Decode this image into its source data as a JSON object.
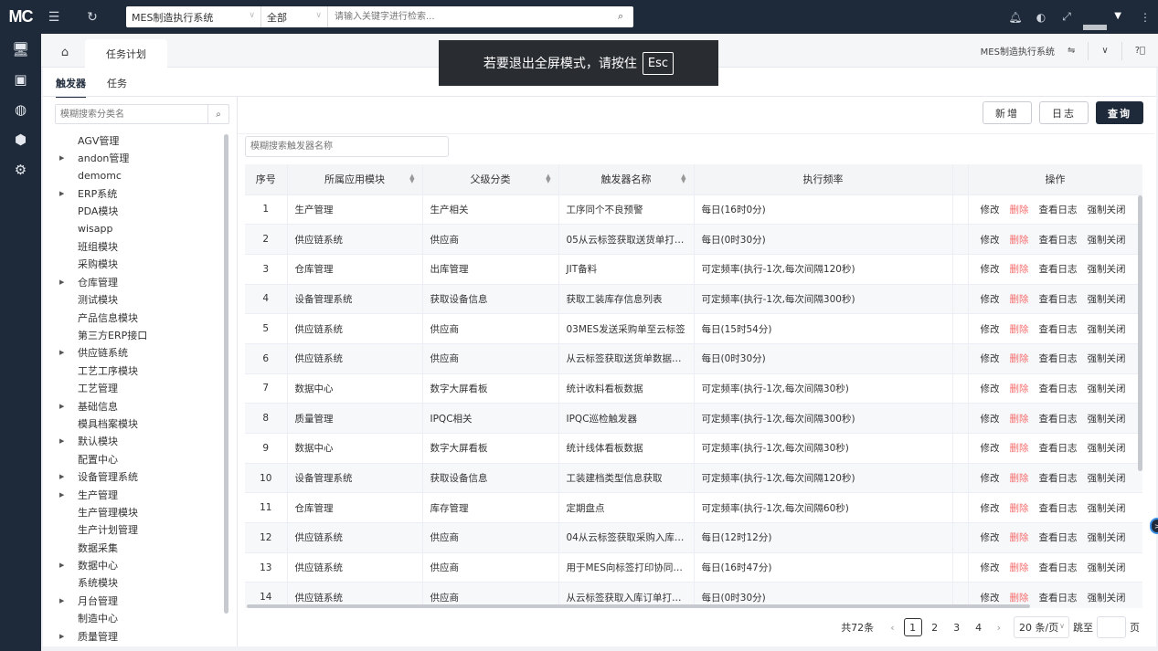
{
  "topbar": {
    "logo": "MC",
    "system_select": "MES制造执行系统",
    "scope_select": "全部",
    "search_placeholder": "请输入关键字进行检索..."
  },
  "tabs": {
    "active_tab": "任务计划",
    "system_name": "MES制造执行系统"
  },
  "toast": {
    "message": "若要退出全屏模式，请按住",
    "key": "Esc"
  },
  "subtabs": [
    "触发器",
    "任务"
  ],
  "tree": {
    "search_placeholder": "模糊搜索分类名",
    "items": [
      {
        "label": "AGV管理",
        "expandable": false
      },
      {
        "label": "andon管理",
        "expandable": true
      },
      {
        "label": "demomc",
        "expandable": false
      },
      {
        "label": "ERP系统",
        "expandable": true
      },
      {
        "label": "PDA模块",
        "expandable": false
      },
      {
        "label": "wisapp",
        "expandable": false
      },
      {
        "label": "班组模块",
        "expandable": false
      },
      {
        "label": "采购模块",
        "expandable": false
      },
      {
        "label": "仓库管理",
        "expandable": true
      },
      {
        "label": "测试模块",
        "expandable": false
      },
      {
        "label": "产品信息模块",
        "expandable": false
      },
      {
        "label": "第三方ERP接口",
        "expandable": false
      },
      {
        "label": "供应链系统",
        "expandable": true
      },
      {
        "label": "工艺工序模块",
        "expandable": false
      },
      {
        "label": "工艺管理",
        "expandable": false
      },
      {
        "label": "基础信息",
        "expandable": true
      },
      {
        "label": "模具档案模块",
        "expandable": false
      },
      {
        "label": "默认模块",
        "expandable": true
      },
      {
        "label": "配置中心",
        "expandable": false
      },
      {
        "label": "设备管理系统",
        "expandable": true
      },
      {
        "label": "生产管理",
        "expandable": true
      },
      {
        "label": "生产管理模块",
        "expandable": false
      },
      {
        "label": "生产计划管理",
        "expandable": false
      },
      {
        "label": "数据采集",
        "expandable": false
      },
      {
        "label": "数据中心",
        "expandable": true
      },
      {
        "label": "系统模块",
        "expandable": false
      },
      {
        "label": "月台管理",
        "expandable": true
      },
      {
        "label": "制造中心",
        "expandable": false
      },
      {
        "label": "质量管理",
        "expandable": true
      }
    ]
  },
  "toolbar": {
    "add": "新增",
    "log": "日志",
    "query": "查询",
    "trigger_search_placeholder": "模糊搜索触发器名称"
  },
  "table": {
    "headers": [
      "序号",
      "所属应用模块",
      "父级分类",
      "触发器名称",
      "执行频率",
      "",
      "操作"
    ],
    "ops": [
      "修改",
      "删除",
      "查看日志",
      "强制关闭"
    ],
    "rows": [
      [
        "1",
        "生产管理",
        "生产相关",
        "工序同个不良预警",
        "每日(16时0分)"
      ],
      [
        "2",
        "供应链系统",
        "供应商",
        "05从云标签获取送货单打…",
        "每日(0时30分)"
      ],
      [
        "3",
        "仓库管理",
        "出库管理",
        "JIT备料",
        "可定频率(执行-1次,每次间隔120秒)"
      ],
      [
        "4",
        "设备管理系统",
        "获取设备信息",
        "获取工装库存信息列表",
        "可定频率(执行-1次,每次间隔300秒)"
      ],
      [
        "5",
        "供应链系统",
        "供应商",
        "03MES发送采购单至云标签",
        "每日(15时54分)"
      ],
      [
        "6",
        "供应链系统",
        "供应商",
        "从云标签获取送货单数据…",
        "每日(0时30分)"
      ],
      [
        "7",
        "数据中心",
        "数字大屏看板",
        "统计收料看板数据",
        "可定频率(执行-1次,每次间隔30秒)"
      ],
      [
        "8",
        "质量管理",
        "IPQC相关",
        "IPQC巡检触发器",
        "可定频率(执行-1次,每次间隔300秒)"
      ],
      [
        "9",
        "数据中心",
        "数字大屏看板",
        "统计线体看板数据",
        "可定频率(执行-1次,每次间隔30秒)"
      ],
      [
        "10",
        "设备管理系统",
        "获取设备信息",
        "工装建档类型信息获取",
        "可定频率(执行-1次,每次间隔120秒)"
      ],
      [
        "11",
        "仓库管理",
        "库存管理",
        "定期盘点",
        "可定频率(执行-1次,每次间隔60秒)"
      ],
      [
        "12",
        "供应链系统",
        "供应商",
        "04从云标签获取采购入库…",
        "每日(12时12分)"
      ],
      [
        "13",
        "供应链系统",
        "供应商",
        "用于MES向标签打印协同…",
        "每日(16时47分)"
      ],
      [
        "14",
        "供应链系统",
        "供应商",
        "从云标签获取入库订单打…",
        "每日(0时30分)"
      ]
    ]
  },
  "pagination": {
    "total": "共72条",
    "pages": [
      "1",
      "2",
      "3",
      "4"
    ],
    "page_size": "20 条/页",
    "jump_label": "跳至",
    "page_suffix": "页"
  },
  "colors": {
    "nav_bg": "#1e2a3a",
    "danger": "#f56c6c"
  }
}
